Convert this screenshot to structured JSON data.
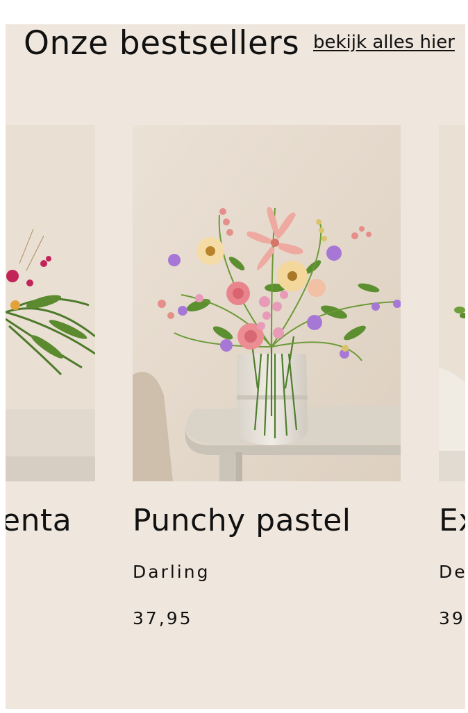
{
  "section": {
    "title": "Onze bestsellers",
    "view_all_label": "bekijk alles hier"
  },
  "products": [
    {
      "name_visible": "enta"
    },
    {
      "name": "Punchy pastel",
      "variant": "Darling",
      "price": "37,95"
    },
    {
      "name_visible": "Ex",
      "variant_visible": "De",
      "price_visible": "39"
    }
  ],
  "colors": {
    "panel_background": "#efe7dd",
    "text": "#111111",
    "image_wall": "#e7dccf",
    "table": "#ddd6cb"
  }
}
